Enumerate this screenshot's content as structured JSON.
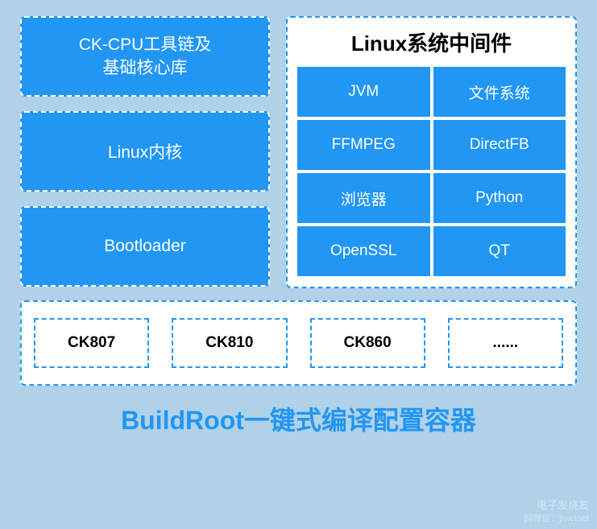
{
  "left": {
    "ckcpu": "CK-CPU工具链及\n基础核心库",
    "kernel": "Linux内核",
    "bootloader": "Bootloader"
  },
  "middleware": {
    "title": "Linux系统中间件",
    "cells": [
      "JVM",
      "文件系统",
      "FFMPEG",
      "DirectFB",
      "浏览器",
      "Python",
      "OpenSSL",
      "QT"
    ]
  },
  "chips": [
    "CK807",
    "CK810",
    "CK860",
    "......"
  ],
  "footer": "BuildRoot一键式编译配置容器",
  "watermark": {
    "line1": "电子发烧友",
    "line2": "网微信：jiweinet"
  }
}
